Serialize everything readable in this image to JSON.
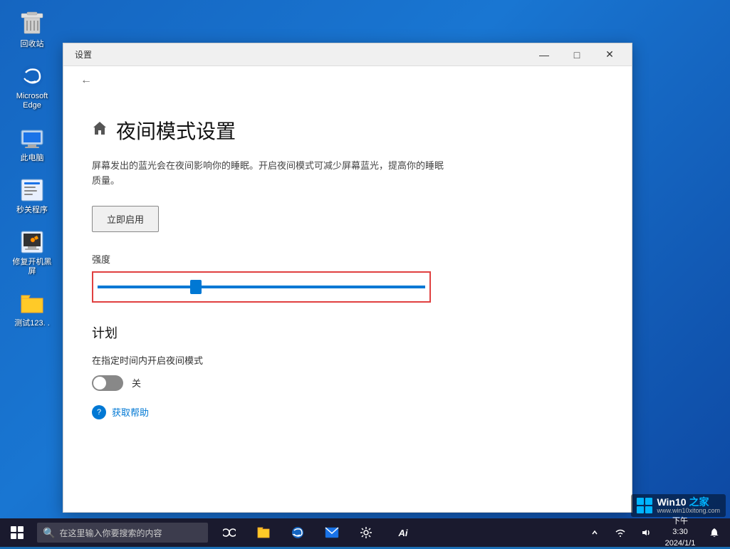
{
  "desktop": {
    "icons": [
      {
        "id": "recycle-bin",
        "label": "回收站",
        "icon": "🗑"
      },
      {
        "id": "edge",
        "label": "Microsoft Edge",
        "icon": "🌐"
      },
      {
        "id": "this-pc",
        "label": "此电脑",
        "icon": "💻"
      },
      {
        "id": "quick-prog",
        "label": "秒关程序",
        "icon": "📋"
      },
      {
        "id": "repair",
        "label": "修复开机黑屏",
        "icon": "🔧"
      },
      {
        "id": "test123",
        "label": "测试123. .",
        "icon": "📁"
      }
    ]
  },
  "taskbar": {
    "search_placeholder": "在这里输入你要搜索的内容",
    "ai_label": "Ai"
  },
  "settings_window": {
    "title": "设置",
    "page_title": "夜间模式设置",
    "description": "屏幕发出的蓝光会在夜间影响你的睡眠。开启夜间模式可减少屏幕蓝光，提高你的睡眠质量。",
    "activate_btn": "立即启用",
    "intensity_label": "强度",
    "slider_value": 30,
    "schedule_section": "计划",
    "schedule_desc": "在指定时间内开启夜间模式",
    "toggle_state": "off",
    "toggle_label": "关",
    "help_link": "获取帮助"
  },
  "corner_badge": {
    "line1": "Win10 之家",
    "line2": "www.win10xitong.com"
  },
  "window_controls": {
    "minimize": "—",
    "maximize": "□",
    "close": "✕"
  }
}
